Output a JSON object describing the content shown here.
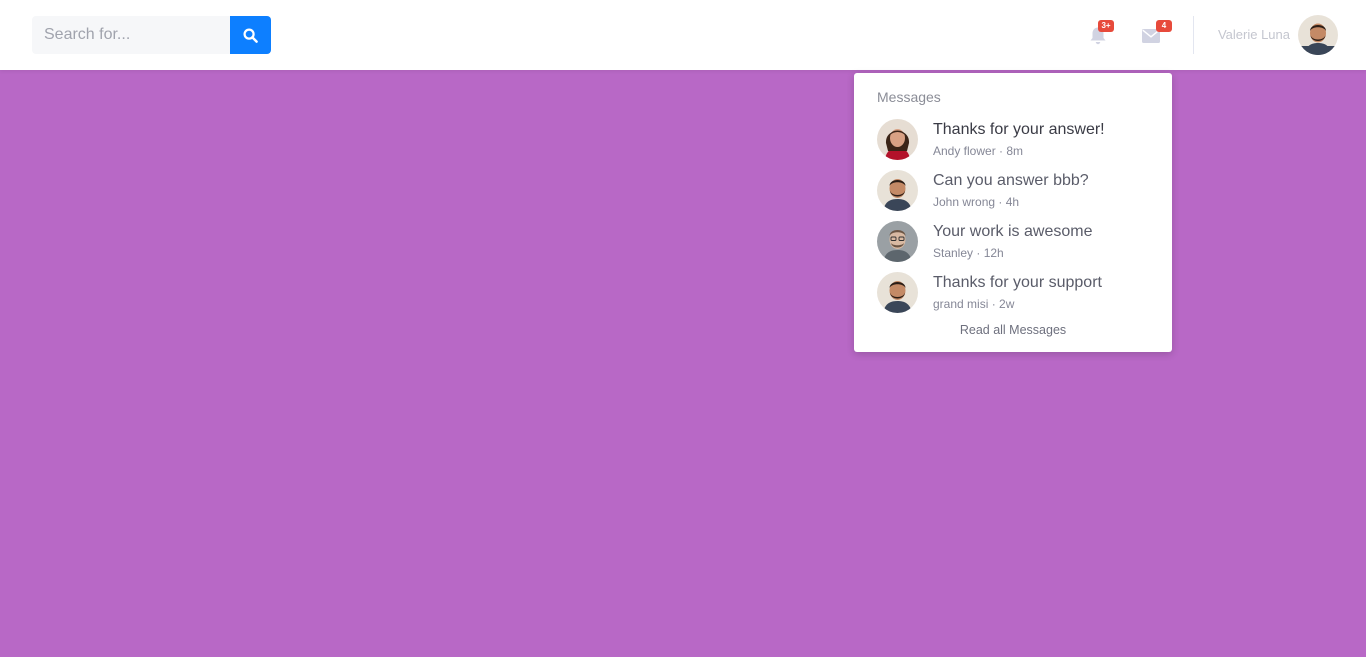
{
  "search": {
    "placeholder": "Search for..."
  },
  "header": {
    "notifications_badge": "3+",
    "messages_badge": "4",
    "user_name": "Valerie Luna"
  },
  "messages": {
    "header": "Messages",
    "items": [
      {
        "title": "Thanks for your answer!",
        "meta": "Andy flower · 8m"
      },
      {
        "title": "Can you answer bbb?",
        "meta": "John wrong · 4h"
      },
      {
        "title": "Your work is awesome",
        "meta": "Stanley · 12h"
      },
      {
        "title": "Thanks for your support",
        "meta": "grand misi · 2w"
      }
    ],
    "read_all_label": "Read all Messages"
  },
  "colors": {
    "background": "#b868c6",
    "accent": "#0d7fff",
    "badge": "#e74a3b"
  }
}
